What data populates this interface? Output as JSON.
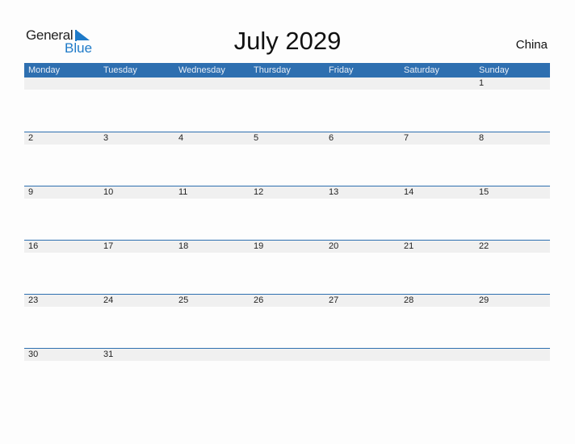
{
  "logo": {
    "word1": "General",
    "word2": "Blue"
  },
  "title": "July 2029",
  "country": "China",
  "colors": {
    "header": "#2e6fb0",
    "band": "#f0f0f0",
    "logo_blue": "#1e7ac8"
  },
  "weekdays": [
    "Monday",
    "Tuesday",
    "Wednesday",
    "Thursday",
    "Friday",
    "Saturday",
    "Sunday"
  ],
  "weeks": [
    [
      "",
      "",
      "",
      "",
      "",
      "",
      "1"
    ],
    [
      "2",
      "3",
      "4",
      "5",
      "6",
      "7",
      "8"
    ],
    [
      "9",
      "10",
      "11",
      "12",
      "13",
      "14",
      "15"
    ],
    [
      "16",
      "17",
      "18",
      "19",
      "20",
      "21",
      "22"
    ],
    [
      "23",
      "24",
      "25",
      "26",
      "27",
      "28",
      "29"
    ],
    [
      "30",
      "31",
      "",
      "",
      "",
      "",
      ""
    ]
  ]
}
